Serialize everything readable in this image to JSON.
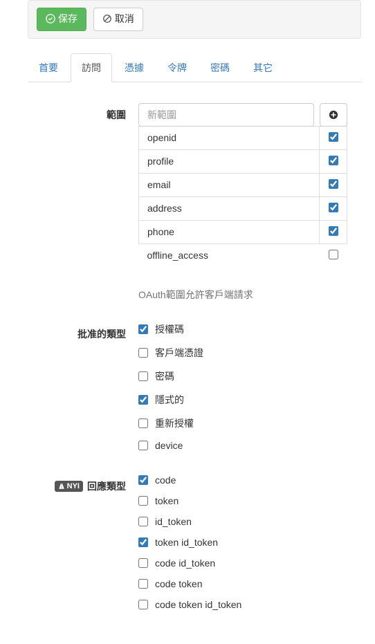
{
  "toolbar": {
    "save_label": "保存",
    "cancel_label": "取消"
  },
  "tabs": {
    "items": [
      {
        "label": "首要",
        "active": false
      },
      {
        "label": "訪問",
        "active": true
      },
      {
        "label": "憑據",
        "active": false
      },
      {
        "label": "令牌",
        "active": false
      },
      {
        "label": "密碼",
        "active": false
      },
      {
        "label": "其它",
        "active": false
      }
    ]
  },
  "scope_section": {
    "label": "範圍",
    "placeholder": "新範圍",
    "help": "OAuth範圍允許客戶端請求",
    "items": [
      {
        "name": "openid",
        "checked": true
      },
      {
        "name": "profile",
        "checked": true
      },
      {
        "name": "email",
        "checked": true
      },
      {
        "name": "address",
        "checked": true
      },
      {
        "name": "phone",
        "checked": true
      },
      {
        "name": "offline_access",
        "checked": false
      }
    ]
  },
  "grant_types_section": {
    "label": "批准的類型",
    "items": [
      {
        "name": "授權碼",
        "checked": true
      },
      {
        "name": "客戶端憑證",
        "checked": false
      },
      {
        "name": "密碼",
        "checked": false
      },
      {
        "name": "隱式的",
        "checked": true
      },
      {
        "name": "重新授權",
        "checked": false
      },
      {
        "name": "device",
        "checked": false
      }
    ]
  },
  "response_types_section": {
    "label": "回應類型",
    "badge": "NYI",
    "items": [
      {
        "name": "code",
        "checked": true
      },
      {
        "name": "token",
        "checked": false
      },
      {
        "name": "id_token",
        "checked": false
      },
      {
        "name": "token id_token",
        "checked": true
      },
      {
        "name": "code id_token",
        "checked": false
      },
      {
        "name": "code token",
        "checked": false
      },
      {
        "name": "code token id_token",
        "checked": false
      }
    ]
  }
}
